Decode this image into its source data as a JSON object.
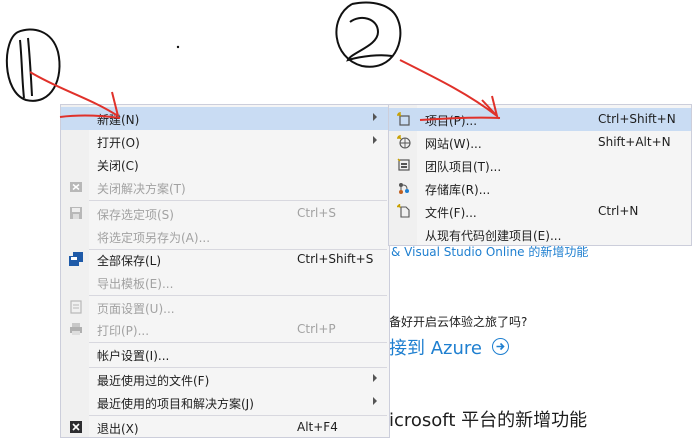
{
  "annotations": {
    "circle_1": "1",
    "circle_2": "2"
  },
  "background": {
    "line1": "& Visual Studio Online 的新增功能",
    "line2": "备好开启云体验之旅了吗?",
    "line3": "接到 Azure",
    "line4": "icrosoft 平台的新增功能"
  },
  "file_menu": {
    "items": [
      {
        "label": "新建(N)",
        "submenu": true
      },
      {
        "label": "打开(O)",
        "submenu": true
      },
      {
        "label": "关闭(C)"
      },
      {
        "label": "关闭解决方案(T)",
        "disabled": true
      },
      {
        "label": "保存选定项(S)",
        "shortcut": "Ctrl+S",
        "disabled": true
      },
      {
        "label": "将选定项另存为(A)...",
        "disabled": true
      },
      {
        "label": "全部保存(L)",
        "shortcut": "Ctrl+Shift+S"
      },
      {
        "label": "导出模板(E)...",
        "disabled": true
      },
      {
        "label": "页面设置(U)...",
        "disabled": true
      },
      {
        "label": "打印(P)...",
        "shortcut": "Ctrl+P",
        "disabled": true
      },
      {
        "label": "帐户设置(I)..."
      },
      {
        "label": "最近使用过的文件(F)",
        "submenu": true
      },
      {
        "label": "最近使用的项目和解决方案(J)",
        "submenu": true
      },
      {
        "label": "退出(X)",
        "shortcut": "Alt+F4"
      }
    ]
  },
  "new_submenu": {
    "items": [
      {
        "label": "项目(P)...",
        "shortcut": "Ctrl+Shift+N"
      },
      {
        "label": "网站(W)...",
        "shortcut": "Shift+Alt+N"
      },
      {
        "label": "团队项目(T)..."
      },
      {
        "label": "存储库(R)..."
      },
      {
        "label": "文件(F)...",
        "shortcut": "Ctrl+N"
      },
      {
        "label": "从现有代码创建项目(E)..."
      }
    ]
  },
  "colors": {
    "highlight": "#c9dcf3",
    "annotation_red": "#e0312a",
    "link_blue": "#1e7fd0"
  }
}
